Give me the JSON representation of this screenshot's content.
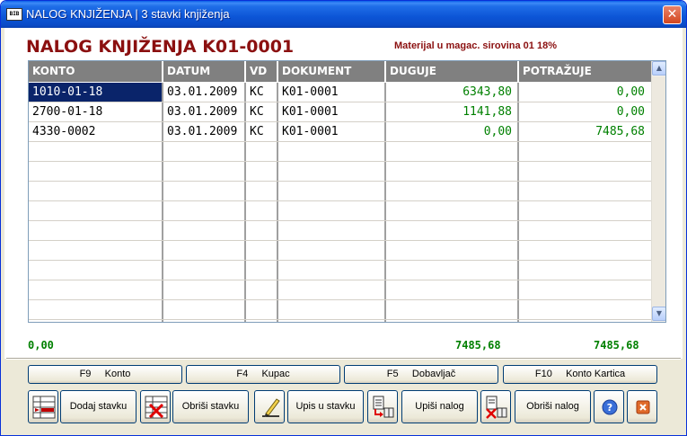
{
  "window": {
    "title": "NALOG KNJIŽENJA | 3 stavki knjiženja",
    "logo_text": "BIB",
    "close_glyph": "✕"
  },
  "form": {
    "title": "NALOG KNJIŽENJA K01-0001",
    "subtitle": "Materijal u magac. sirovina 01  18%"
  },
  "grid": {
    "columns": [
      "KONTO",
      "DATUM",
      "VD",
      "DOKUMENT",
      "DUGUJE",
      "POTRAŽUJE"
    ],
    "rows": [
      {
        "konto": "1010-01-18",
        "datum": "03.01.2009",
        "vd": "KC",
        "dokument": "K01-0001",
        "duguje": "6343,80",
        "potrazuje": "0,00"
      },
      {
        "konto": "2700-01-18",
        "datum": "03.01.2009",
        "vd": "KC",
        "dokument": "K01-0001",
        "duguje": "1141,88",
        "potrazuje": "0,00"
      },
      {
        "konto": "4330-0002",
        "datum": "03.01.2009",
        "vd": "KC",
        "dokument": "K01-0001",
        "duguje": "0,00",
        "potrazuje": "7485,68"
      }
    ],
    "selected_row": 0
  },
  "totals": {
    "left": "0,00",
    "duguje": "7485,68",
    "potrazuje": "7485,68"
  },
  "function_keys": [
    {
      "label": "F9     Konto"
    },
    {
      "label": "F4     Kupac"
    },
    {
      "label": "F5     Dobavljač"
    },
    {
      "label": "F10     Konto Kartica"
    }
  ],
  "actions": {
    "add_row": "Dodaj stavku",
    "delete_row": "Obriši stavku",
    "write_row": "Upis u stavku",
    "write_order": "Upiši nalog",
    "delete_order": "Obriši nalog"
  },
  "icons": {
    "add": "add-row-icon",
    "delete": "delete-row-icon",
    "pencil": "pencil-icon",
    "write_doc": "write-document-icon",
    "delete_doc": "delete-document-icon",
    "help": "help-icon",
    "exit": "exit-icon"
  },
  "colors": {
    "title": "#8b1010",
    "header_bg": "#808080",
    "selection": "#0a246a",
    "numbers": "#008000"
  }
}
